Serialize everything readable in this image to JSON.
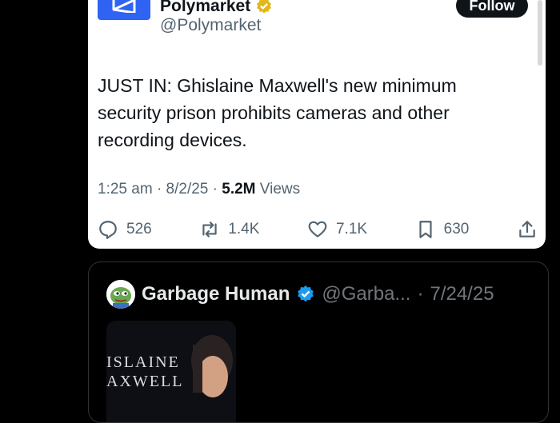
{
  "tweet": {
    "author_name": "Polymarket",
    "author_handle": "@Polymarket",
    "follow_label": "Follow",
    "text": "JUST IN: Ghislaine Maxwell's new minimum security prison prohibits cameras and other recording devices.",
    "time": "1:25 am",
    "date": "8/2/25",
    "views_count": "5.2M",
    "views_label": "Views",
    "replies": "526",
    "reposts": "1.4K",
    "likes": "7.1K",
    "bookmarks": "630"
  },
  "quoted": {
    "author_name": "Garbage Human",
    "author_handle": "@Garba...",
    "date": "7/24/25",
    "image_caption_line1": "ISLAINE",
    "image_caption_line2": "AXWELL"
  },
  "colors": {
    "polymarket_blue": "#2f63f3",
    "verified_gold": "#e2b719",
    "verified_blue": "#1d9bf0"
  }
}
